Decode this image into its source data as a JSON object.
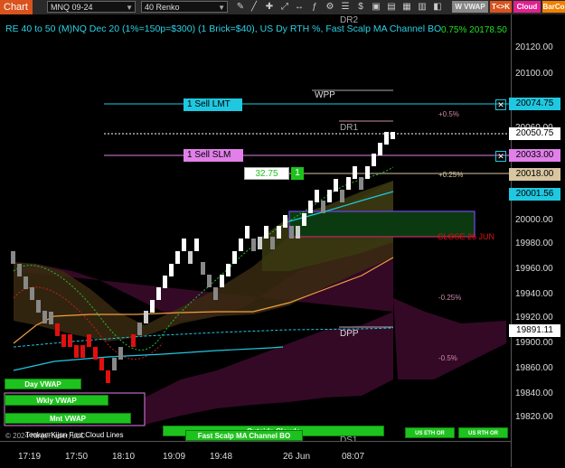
{
  "toolbar": {
    "chart_label": "Chart",
    "instrument": "MNQ 09-24",
    "period": "40 Renko",
    "buttons": [
      "W VWAP",
      "T<>K",
      "Cloud",
      "BarCo"
    ]
  },
  "title": "RE 40 to 50 (M)NQ Dec 20 (1%=150p=$300) (1 Brick=$40), US Dy RTH %, Fast Scalp MA Channel BO",
  "top_right_readout": "0.75% 20178.50",
  "y_axis": [
    "20120.00",
    "20100.00",
    "20080.00",
    "20060.00",
    "20040.00",
    "20020.00",
    "20000.00",
    "19980.00",
    "19960.00",
    "19940.00",
    "19920.00",
    "19900.00",
    "19880.00",
    "19860.00",
    "19840.00",
    "19820.00"
  ],
  "x_axis": [
    "17:19",
    "17:50",
    "18:10",
    "19:09",
    "19:48",
    "26 Jun",
    "08:07"
  ],
  "price_boxes": [
    {
      "label": "20074.75",
      "bg": "#1fc8e0",
      "fg": "#000"
    },
    {
      "label": "20050.75",
      "bg": "#ffffff",
      "fg": "#000"
    },
    {
      "label": "20033.00",
      "bg": "#e080e8",
      "fg": "#000"
    },
    {
      "label": "20018.00",
      "bg": "#d8c6a0",
      "fg": "#000"
    },
    {
      "label": "20001.56",
      "bg": "#1fc8e0",
      "fg": "#000"
    },
    {
      "label": "19891.11",
      "bg": "#ffffff",
      "fg": "#000"
    }
  ],
  "orders": {
    "sell_lmt": "1 Sell LMT",
    "sell_slm": "1 Sell SLM",
    "qty_price": "32.75",
    "qty": "1"
  },
  "levels": {
    "dr2": "DR2",
    "wpp": "WPP",
    "dr1": "DR1",
    "dpp": "DPP",
    "ds1": "DS1",
    "close": "CLOSE 26 JUN"
  },
  "percents": {
    "p05": "+0.5%",
    "p025": "+0.25%",
    "m025": "-0.25%",
    "m05": "-0.5%"
  },
  "vwap_buttons": {
    "day": "Day VWAP",
    "wkly": "Wkly VWAP",
    "mnt": "Mnt VWAP",
    "outside_clouds": "Outside Clouds",
    "fast_scalp": "Fast Scalp MA Channel BO",
    "us_eth1": "US ETH OR",
    "us_rth": "US RTH OR"
  },
  "footer_left": "© 2024 NinjaTrader, LLC",
  "footer_cloud": "Tenkan-Kijun Fast Cloud Lines",
  "colors": {
    "accent": "#d9531e",
    "cyan": "#1fc8e0",
    "magenta": "#e080e8",
    "green": "#1ec21e"
  }
}
